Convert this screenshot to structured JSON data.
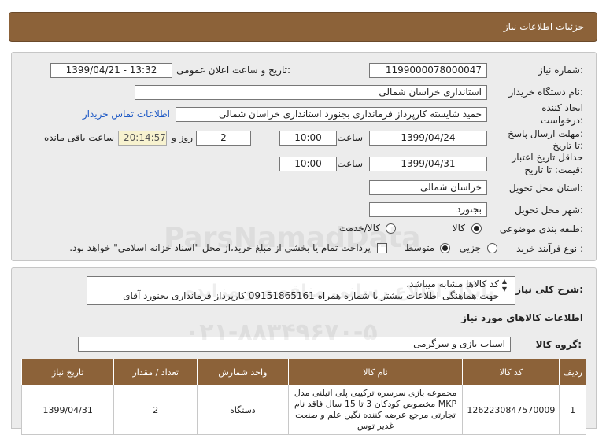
{
  "header": {
    "title": "جزئیات اطلاعات نیاز"
  },
  "form": {
    "need_number_label": "شماره نیاز:",
    "need_number": "1199000078000047",
    "announce_label": "تاریخ و ساعت اعلان عمومی:",
    "announce_value": "1399/04/21 - 13:32",
    "buyer_org_label": "نام دستگاه خریدار:",
    "buyer_org": "استانداری خراسان شمالی",
    "creator_label_1": "ایجاد کننده",
    "creator_label_2": "درخواست:",
    "creator": "حمید  شایسته  کارپرداز فرمانداری بجنورد استانداری خراسان شمالی",
    "contact_link": "اطلاعات تماس خریدار",
    "deadline_label_1": "مهلت ارسال پاسخ:",
    "deadline_label_2": "تا تاریخ:",
    "deadline_date": "1399/04/24",
    "time_label": "ساعت",
    "deadline_time": "10:00",
    "days_value": "2",
    "days_label": "روز و",
    "countdown": "20:14:57",
    "remaining_label": "ساعت باقی مانده",
    "validity_label_1": "حداقل تاریخ اعتبار",
    "validity_label_2": "قیمت: تا تاریخ:",
    "validity_date": "1399/04/31",
    "validity_time": "10:00",
    "province_label": "استان محل تحویل:",
    "province": "خراسان شمالی",
    "city_label": "شهر محل تحویل:",
    "city": "بجنورد",
    "category_label": "طبقه بندی موضوعی:",
    "category_options": [
      "کالا",
      "کالا/خدمت"
    ],
    "category_selected": "کالا",
    "process_label": "نوع فرآیند خرید :",
    "process_options": [
      "جزیی",
      "متوسط"
    ],
    "process_selected": "متوسط",
    "payment_note": "پرداخت تمام یا بخشی از مبلغ خرید،از محل \"اسناد خزانه اسلامی\" خواهد بود."
  },
  "details": {
    "general_desc_label": "شرح کلی نیاز:",
    "general_desc_lines": [
      "کد کالاها مشابه میباشد.",
      "جهت هماهنگی اطلاعات بیشتر با شماره همراه 09151865161 کارپرداز فرمانداری بجنورد آقای شایسته"
    ],
    "goods_info_title": "اطلاعات کالاهای مورد نیاز",
    "goods_group_label": "گروه کالا:",
    "goods_group": "اسباب بازی و سرگرمی",
    "table": {
      "headers": [
        "ردیف",
        "کد کالا",
        "نام کالا",
        "واحد شمارش",
        "تعداد / مقدار",
        "تاریخ نیاز"
      ],
      "rows": [
        {
          "row": "1",
          "code": "1262230847570009",
          "name": "مجموعه بازی سرسره ترکیبی پلی اتیلنی مدل MKP مخصوص کودکان 3 تا 15 سال فاقد نام تجارتی مرجع عرضه کننده نگین علم و صنعت غدیر توس",
          "unit": "دستگاه",
          "qty": "2",
          "date": "1399/04/31"
        }
      ]
    }
  },
  "watermark": {
    "brand": "ParsNamadData",
    "line1": "پایگاه اطلاع رسانی مناقصه و مزایده",
    "phone": "۰۲۱-۸۸۳۴۹۶۷۰-۵"
  }
}
